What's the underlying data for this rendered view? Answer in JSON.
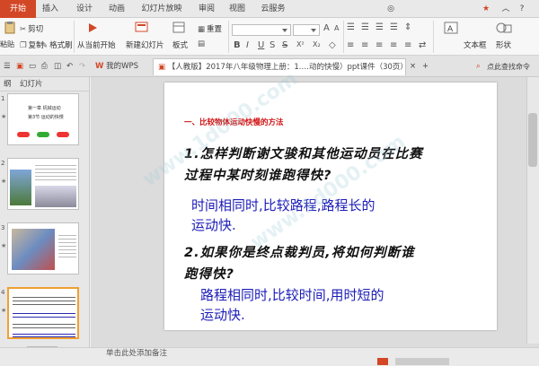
{
  "tabs": [
    "开始",
    "插入",
    "设计",
    "动画",
    "幻灯片放映",
    "审阅",
    "视图",
    "云服务"
  ],
  "ribbon": {
    "cut": "剪切",
    "paste": "粘贴",
    "copy": "复制",
    "format_painter": "格式刷",
    "from_current": "从当前开始",
    "new_slide": "新建幻灯片",
    "layout": "板式",
    "reset": "重置",
    "textbox": "文本框",
    "shape": "形状"
  },
  "doc_tabs": {
    "my_wps": "我的WPS",
    "doc_title": "【人教版】2017年八年级物理上册：1.…动的快慢）ppt课件（30页）.ppt",
    "login": "点此查找命令"
  },
  "left_panel": {
    "tab1": "纲",
    "tab2": "幻灯片",
    "slide_numbers": [
      "1",
      "2",
      "3",
      "4"
    ]
  },
  "thumbs": {
    "t1_line1": "第一章  机械运动",
    "t1_line2": "第3节  运动的快慢"
  },
  "slide": {
    "title": "一、比较物体运动快慢的方法",
    "q1_line1": "1.怎样判断谢文骏和其他运动员在比赛",
    "q1_line2": "过程中某时刻谁跑得快?",
    "a1_line1": "时间相同时,比较路程,路程长的",
    "a1_line2": "运动快.",
    "q2_line1": "2.如果你是终点裁判员,将如何判断谁",
    "q2_line2": "跑得快?",
    "a2_line1": "路程相同时,比较时间,用时短的",
    "a2_line2": "运动快."
  },
  "status": {
    "notes_hint": "单击此处添加备注"
  },
  "colors": {
    "accent": "#d24726",
    "slide_title": "#d01010",
    "answer_text": "#1d1db8"
  }
}
